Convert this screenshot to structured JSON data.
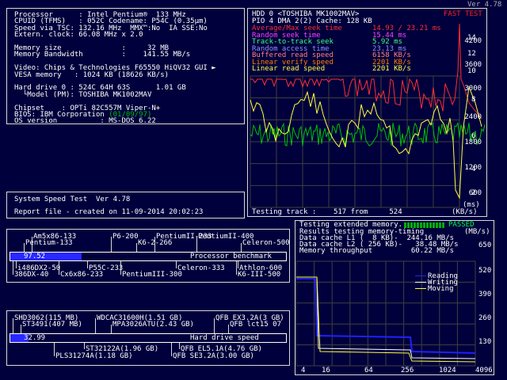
{
  "version": "Ver 4.78",
  "sysinfo": {
    "lines": [
      "Processor      : Intel Pentium®  133 MHz",
      "CPUID (TFMS)   : 052C Codename: P54C (0.35µm)",
      "Speed via TSC: 132.16 MHz  MMX™:No  IA SSE:No",
      "Extern. clock: 66.08 MHz x 2.0",
      "",
      "Memory size              :     32 MB",
      "Memory Bandwidth         :    141.55 MB/s",
      "",
      "Video: Chips & Technologies F65550 HiQV32 GUI ►",
      "VESA memory   : 1024 KB (18626 KB/s)",
      "",
      "Hard drive 0 : 524C 64H 63S      1.01 GB",
      "  └Model (PM): TOSHIBA MK1002MAV",
      "",
      "Chipset    : OPTi 82C557M Viper-N+",
      "BIOS: IBM Corporation ",
      "OS version          : MS-DOS 6.22"
    ],
    "bios_date": "(01/09/97)"
  },
  "speedtest": {
    "title": "System Speed Test  Ver 4.78",
    "report": "Report file - created on 11-09-2014 20:02:23"
  },
  "hdd": {
    "title": "HDD 0 <TOSHIBA MK1002MAV>",
    "mode": "FAST TEST",
    "pio": "PIO 4 DMA 2(2) Cache: 128 KB",
    "stats": [
      {
        "label": "Average/Max seek time",
        "value": "14.93 / 23.21 ms",
        "color": "#ff3030"
      },
      {
        "label": "Random seek time     ",
        "value": "15.44 ms",
        "color": "#ff40ff"
      },
      {
        "label": "Track-to-track seek  ",
        "value": "5.92 ms",
        "color": "#40ff80"
      },
      {
        "label": "Random access time   ",
        "value": "23.13 ms",
        "color": "#9090ff"
      },
      {
        "label": "Buffered read speed  ",
        "value": "6158 KB/s",
        "color": "#ff8080"
      },
      {
        "label": "Linear verify speed  ",
        "value": "2201 KB/s",
        "color": "#ff8000"
      },
      {
        "label": "Linear read speed    ",
        "value": "2201 KB/s",
        "color": "#ffff40"
      }
    ],
    "axis_ms": [
      "14",
      "12",
      "10",
      "8",
      "6",
      "4",
      "2"
    ],
    "axis_kb": [
      "4200",
      "3600",
      "3000",
      "2400",
      "1800",
      "1200",
      "600"
    ],
    "axis_ms_unit": "(ms)",
    "axis_kb_unit": "(KB/s)",
    "testing": "Testing track :    517 from     524"
  },
  "cpu_bench": {
    "top_labels": [
      "Am5x86-133",
      "P6-200",
      "PentiumII-233",
      "PentiumII-400",
      "Pentium-133",
      "K6-2-266",
      "Celeron-500"
    ],
    "value": "97.52",
    "fraction": 0.26,
    "caption": "Processor benchmark",
    "bottom_labels": [
      "i486DX2-50",
      "P55C-233",
      "Celeron-333",
      "Athlon-600",
      "386DX-40",
      "Cx6x86-233",
      "PentiumIII-300",
      "K6-III-500"
    ]
  },
  "hdd_bench": {
    "top_labels": [
      "SHD3062(115 MB)",
      "WDCAC31600H(1.51 GB)",
      "QFB EX3.2A(3 GB)",
      "ST3491(407 MB)",
      "MPA3026ATU(2.43 GB)",
      "QFB lct15 07"
    ],
    "value": "32.99",
    "fraction": 0.065,
    "caption": "Hard drive speed",
    "bottom_labels": [
      "ST32122A(1.96 GB)",
      "QFB EL5.1A(4.76 GB)",
      "PLS31274A(1.18 GB)",
      "QFB SE3.2A(3.00 GB)"
    ]
  },
  "memtest": {
    "status": "Testing extended memory...",
    "passed": "PASSED",
    "results_line": "Results testing memory-timing",
    "unit": "(MB/s)",
    "l1": "Data cache L1 (  8 KB)-  244.16 MB/s",
    "l2": "Data cache L2 ( 256 KB)-   38.48 MB/s",
    "throughput": "Memory throughput         60.22 MB/s",
    "legend": [
      "Reading",
      "Writing",
      "Moving"
    ],
    "y_axis": [
      "650",
      "520",
      "390",
      "260",
      "130"
    ],
    "x_axis": [
      "4",
      "16",
      "64",
      "256",
      "1024",
      "4096"
    ],
    "colors": {
      "reading": "#2020ff",
      "writing": "#ffffff",
      "moving": "#ffff40"
    }
  }
}
